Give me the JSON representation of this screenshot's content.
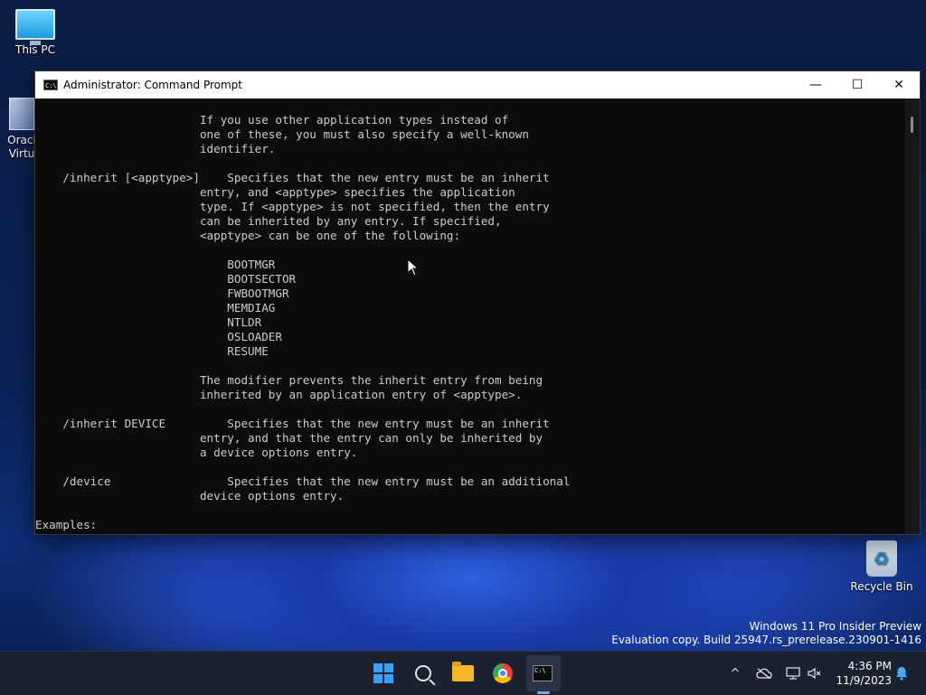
{
  "desktop": {
    "icons": [
      {
        "label": "This PC"
      },
      {
        "label": "Oracl"
      },
      {
        "label": "Virtu"
      },
      {
        "label": "Recycle Bin"
      }
    ],
    "watermark": {
      "line1": "Windows 11 Pro Insider Preview",
      "line2": "Evaluation copy. Build 25947.rs_prerelease.230901-1416"
    }
  },
  "window": {
    "title": "Administrator: Command Prompt",
    "icon_text": "C:\\",
    "controls": {
      "minimize": "—",
      "maximize": "☐",
      "close": "✕"
    },
    "lines": [
      "                        If you use other application types instead of",
      "                        one of these, you must also specify a well-known",
      "                        identifier.",
      "",
      "    /inherit [<apptype>]    Specifies that the new entry must be an inherit",
      "                        entry, and <apptype> specifies the application",
      "                        type. If <apptype> is not specified, then the entry",
      "                        can be inherited by any entry. If specified,",
      "                        <apptype> can be one of the following:",
      "",
      "                            BOOTMGR",
      "                            BOOTSECTOR",
      "                            FWBOOTMGR",
      "                            MEMDIAG",
      "                            NTLDR",
      "                            OSLOADER",
      "                            RESUME",
      "",
      "                        The modifier prevents the inherit entry from being",
      "                        inherited by an application entry of <apptype>.",
      "",
      "    /inherit DEVICE         Specifies that the new entry must be an inherit",
      "                        entry, and that the entry can only be inherited by",
      "                        a device options entry.",
      "",
      "    /device                 Specifies that the new entry must be an additional",
      "                        device options entry.",
      "",
      "Examples:"
    ]
  },
  "taskbar": {
    "apps": [
      {
        "name": "start"
      },
      {
        "name": "search"
      },
      {
        "name": "file-explorer"
      },
      {
        "name": "chrome"
      },
      {
        "name": "command-prompt",
        "icon_text": "C:\\"
      }
    ],
    "tray": {
      "chevron": "^"
    },
    "clock": {
      "time": "4:36 PM",
      "date": "11/9/2023"
    }
  }
}
